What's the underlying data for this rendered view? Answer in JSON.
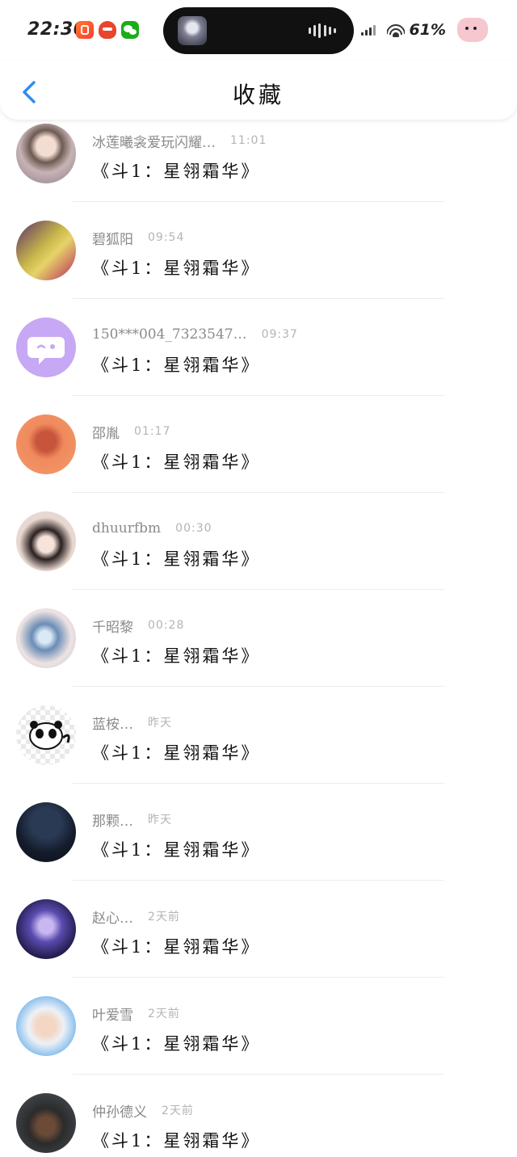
{
  "status_bar": {
    "time": "22:30",
    "battery": "61%",
    "app_icons": [
      "orange-app-icon",
      "red-app-icon",
      "wechat-icon"
    ],
    "right_icons": [
      "signal-icon",
      "wifi-icon",
      "mascot-icon"
    ]
  },
  "header": {
    "title": "收藏",
    "back_icon": "chevron-left-icon",
    "accent_color": "#2f8cf0"
  },
  "list": {
    "items": [
      {
        "name": "冰莲曦衾爱玩闪耀…",
        "time": "11:01",
        "message": "《斗1：星翎霜华》",
        "avatar": "portrait-girl"
      },
      {
        "name": "碧狐阳",
        "time": "09:54",
        "message": "《斗1：星翎霜华》",
        "avatar": "anime-scene"
      },
      {
        "name": "150***004_7323547…",
        "time": "09:37",
        "message": "《斗1：星翎霜华》",
        "avatar": "chat-bubble-default"
      },
      {
        "name": "邵胤",
        "time": "01:17",
        "message": "《斗1：星翎霜华》",
        "avatar": "cartoon-figure"
      },
      {
        "name": "dhuurfbm",
        "time": "00:30",
        "message": "《斗1：星翎霜华》",
        "avatar": "anime-girl"
      },
      {
        "name": "千昭黎",
        "time": "00:28",
        "message": "《斗1：星翎霜华》",
        "avatar": "fantasy-eye"
      },
      {
        "name": "蓝桉…",
        "time": "昨天",
        "message": "《斗1：星翎霜华》",
        "avatar": "panda-sticker"
      },
      {
        "name": "那颗…",
        "time": "昨天",
        "message": "《斗1：星翎霜华》",
        "avatar": "night-sky"
      },
      {
        "name": "赵心…",
        "time": "2天前",
        "message": "《斗1：星翎霜华》",
        "avatar": "fantasy-character"
      },
      {
        "name": "叶爱雪",
        "time": "2天前",
        "message": "《斗1：星翎霜华》",
        "avatar": "baby-photo"
      },
      {
        "name": "仲孙德义",
        "time": "2天前",
        "message": "《斗1：星翎霜华》",
        "avatar": "man-cap"
      }
    ]
  }
}
